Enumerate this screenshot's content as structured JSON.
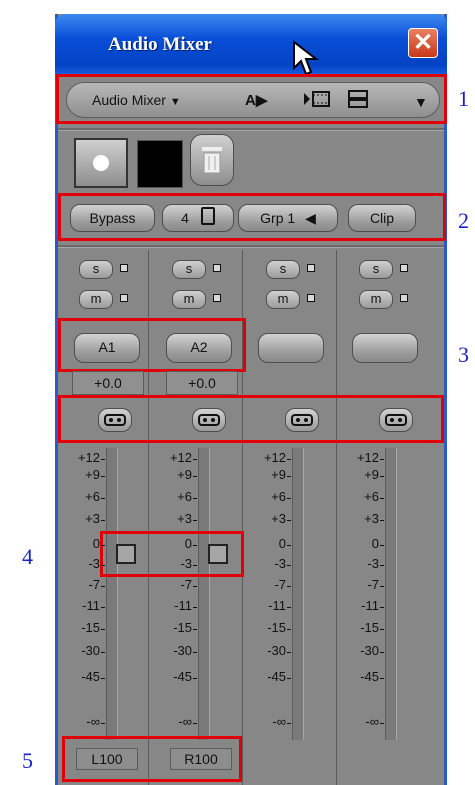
{
  "window": {
    "title": "Audio Mixer",
    "close_symbol": "✕"
  },
  "toolbar": {
    "menu_label": "Audio Mixer",
    "caret": "▼",
    "icons": [
      "a-tracks-icon",
      "video-track-icon",
      "layout-icon"
    ],
    "overflow_caret": "▼"
  },
  "top_controls": {
    "record": "record-button",
    "color_swatch": "#000000",
    "delete": "trash-icon"
  },
  "controls": {
    "bypass": "Bypass",
    "channels": "4",
    "group": "Grp 1",
    "clip": "Clip"
  },
  "tracks": [
    {
      "solo": "s",
      "mute": "m",
      "name": "A1",
      "gain": "+0.0",
      "pan": "L100",
      "fader_db": 0
    },
    {
      "solo": "s",
      "mute": "m",
      "name": "A2",
      "gain": "+0.0",
      "pan": "R100",
      "fader_db": 0
    },
    {
      "solo": "s",
      "mute": "m",
      "name": "",
      "gain": "",
      "pan": "",
      "fader_db": null
    },
    {
      "solo": "s",
      "mute": "m",
      "name": "",
      "gain": "",
      "pan": "",
      "fader_db": null
    }
  ],
  "scale": [
    "+12",
    "+9",
    "+6",
    "+3",
    "0",
    "-3",
    "-7",
    "-11",
    "-15",
    "-30",
    "-45",
    "-∞"
  ],
  "annotations": [
    "1",
    "2",
    "3",
    "4",
    "5"
  ],
  "colors": {
    "titlebar": "#0a4fd8",
    "panel": "#878787",
    "highlight": "#e0000a",
    "annotation": "#1a23c8"
  }
}
